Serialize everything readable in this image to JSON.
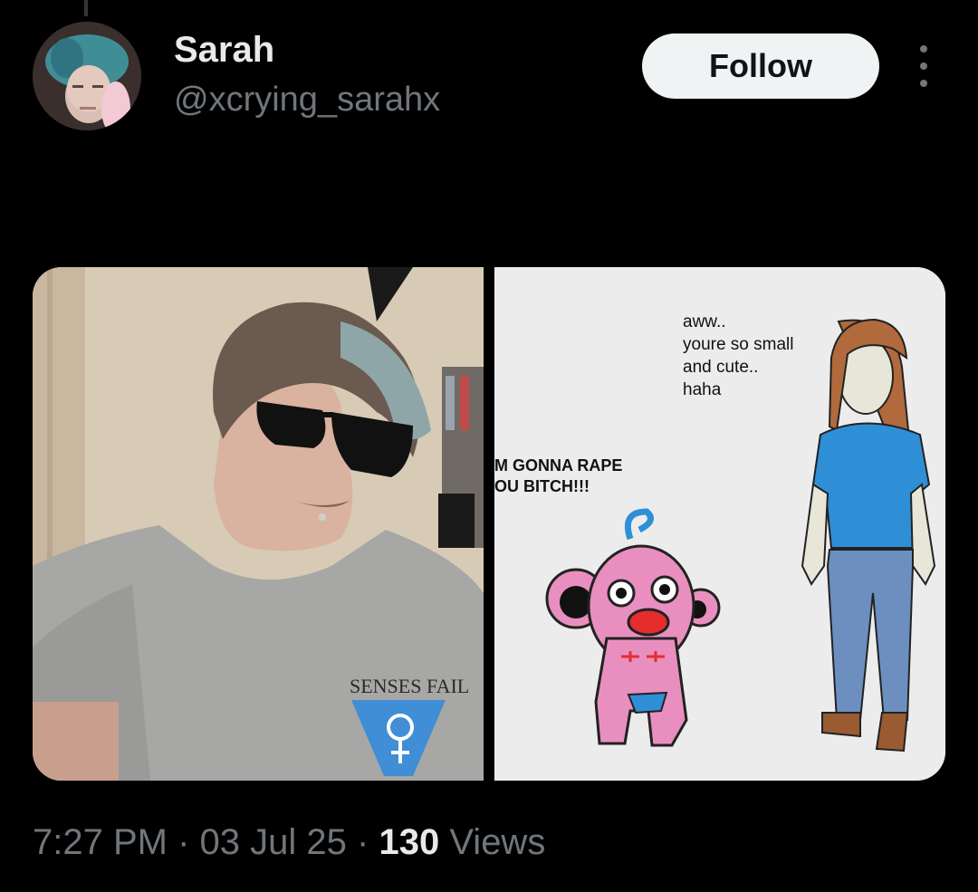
{
  "post": {
    "author": {
      "display_name": "Sarah",
      "handle": "@xcrying_sarahx",
      "avatar": "user-avatar-photo"
    },
    "follow_label": "Follow",
    "more_icon": "more-vertical-icon",
    "media": {
      "left_image": "selfie-photo",
      "right_image": "drawn-comic",
      "comic_text": {
        "speech_1": "aww..\nyoure so small\nand cute..\nhaha",
        "speech_2": "M GONNA RAPE\nOU BITCH!!!"
      },
      "shirt_text": "SENSES FAIL"
    },
    "time": "7:27 PM",
    "separator": "·",
    "date": "03 Jul 25",
    "views_count": "130",
    "views_label": "Views"
  },
  "colors": {
    "background": "#000000",
    "primary_text": "#e7e9ea",
    "secondary_text": "#71767b",
    "follow_bg": "#eff3f4"
  }
}
